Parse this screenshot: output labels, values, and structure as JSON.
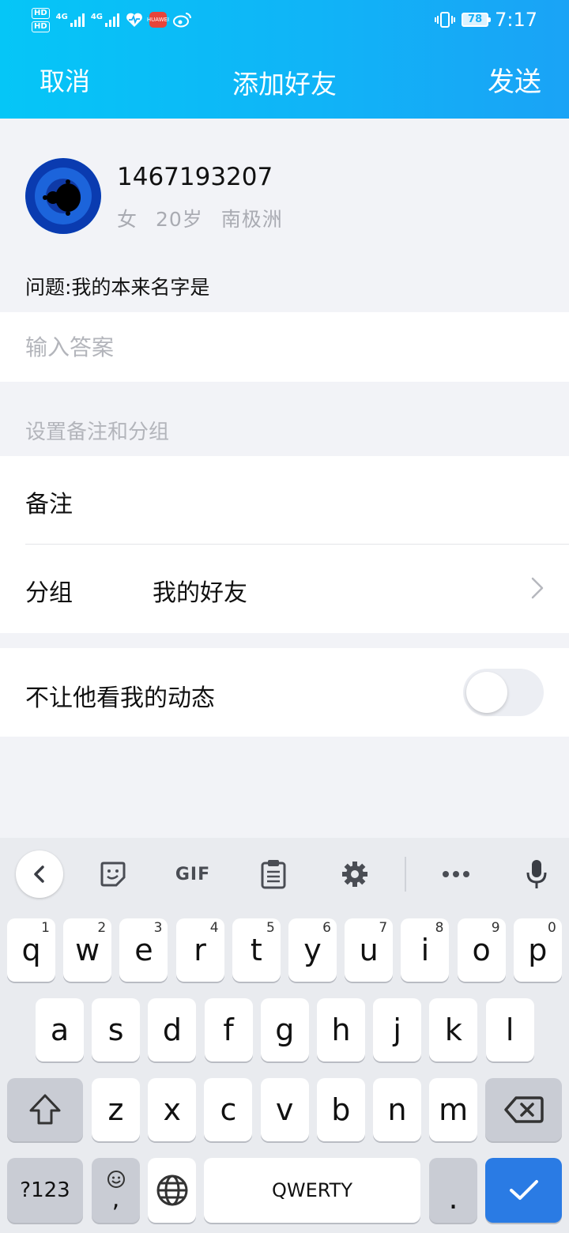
{
  "status_bar": {
    "time": "7:17",
    "battery": "78",
    "hd1": "HD",
    "hd2": "HD",
    "net1": "4G",
    "net2": "4G",
    "huawei_badge": "HUAWEI"
  },
  "nav": {
    "cancel": "取消",
    "title": "添加好友",
    "send": "发送"
  },
  "profile": {
    "user_id": "1467193207",
    "gender": "女",
    "age": "20岁",
    "location": "南极洲",
    "question": "问题:我的本来名字是"
  },
  "answer": {
    "placeholder": "输入答案",
    "value": ""
  },
  "section_label": "设置备注和分组",
  "settings": {
    "remark_label": "备注",
    "remark_value": "",
    "group_label": "分组",
    "group_value": "我的好友"
  },
  "privacy": {
    "hide_moments_label": "不让他看我的动态",
    "hide_moments_on": false
  },
  "keyboard": {
    "toolbar": [
      "back-icon",
      "sticker-icon",
      "GIF",
      "clipboard-icon",
      "gear-icon",
      "more-icon",
      "mic-icon"
    ],
    "gif_label": "GIF",
    "row1": [
      {
        "k": "q",
        "s": "1"
      },
      {
        "k": "w",
        "s": "2"
      },
      {
        "k": "e",
        "s": "3"
      },
      {
        "k": "r",
        "s": "4"
      },
      {
        "k": "t",
        "s": "5"
      },
      {
        "k": "y",
        "s": "6"
      },
      {
        "k": "u",
        "s": "7"
      },
      {
        "k": "i",
        "s": "8"
      },
      {
        "k": "o",
        "s": "9"
      },
      {
        "k": "p",
        "s": "0"
      }
    ],
    "row2": [
      "a",
      "s",
      "d",
      "f",
      "g",
      "h",
      "j",
      "k",
      "l"
    ],
    "row3": [
      "z",
      "x",
      "c",
      "v",
      "b",
      "n",
      "m"
    ],
    "sym_key": "?123",
    "comma_key": ",",
    "space_label": "QWERTY",
    "period_key": ".",
    "accent_color": "#2a7be4"
  }
}
